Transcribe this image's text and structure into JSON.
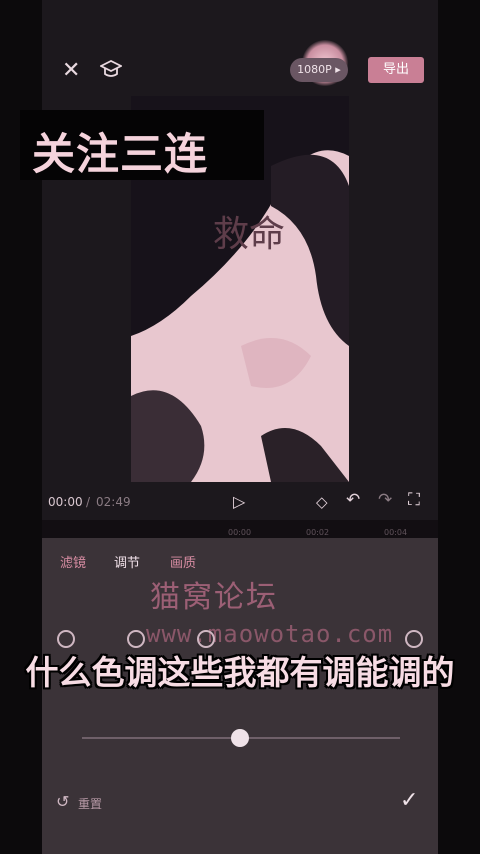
{
  "top_bar": {
    "resolution": "1080P",
    "export_label": "导出"
  },
  "overlay": {
    "caption_top": "关注三连",
    "caption_bottom": "什么色调这些我都有调能调的"
  },
  "preview": {
    "tattoo_text": "救命"
  },
  "playback": {
    "current_time": "00:00",
    "separator": "/",
    "total_time": "02:49"
  },
  "ruler": {
    "ticks": [
      "00:00",
      "00:02",
      "00:04"
    ]
  },
  "panel": {
    "tabs": [
      "滤镜",
      "调节",
      "画质"
    ],
    "active_tab": "调节",
    "reset_label": "重置"
  },
  "watermark": {
    "title": "猫窝论坛",
    "url": "www.maowotao.com"
  },
  "icons": [
    "close-icon",
    "graduation-cap-icon",
    "play-icon",
    "keyframe-icon",
    "undo-icon",
    "redo-icon",
    "fullscreen-icon",
    "reset-icon",
    "check-icon"
  ],
  "colors": {
    "accent": "#c97f95",
    "panel": "#3b3338",
    "caption": "#f5d3dc"
  },
  "slider": {
    "value": 0.5
  }
}
